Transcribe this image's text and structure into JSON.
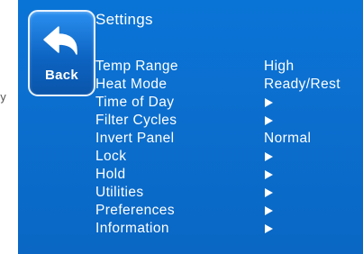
{
  "stray_char": "y",
  "back_button": {
    "label": "Back",
    "icon": "back-arrow-icon"
  },
  "title": "Settings",
  "colors": {
    "screen_background": "#0b6fcf",
    "text": "#ffffff"
  },
  "menu": [
    {
      "label": "Temp Range",
      "value": "High",
      "icon": null
    },
    {
      "label": "Heat Mode",
      "value": "Ready/Rest",
      "icon": null
    },
    {
      "label": "Time of Day",
      "value": null,
      "icon": "arrow-right-icon"
    },
    {
      "label": "Filter Cycles",
      "value": null,
      "icon": "arrow-right-icon"
    },
    {
      "label": "Invert Panel",
      "value": "Normal",
      "icon": null
    },
    {
      "label": "Lock",
      "value": null,
      "icon": "arrow-right-icon"
    },
    {
      "label": "Hold",
      "value": null,
      "icon": "arrow-right-icon"
    },
    {
      "label": "Utilities",
      "value": null,
      "icon": "arrow-right-icon"
    },
    {
      "label": "Preferences",
      "value": null,
      "icon": "arrow-right-icon"
    },
    {
      "label": "Information",
      "value": null,
      "icon": "arrow-right-icon"
    }
  ]
}
